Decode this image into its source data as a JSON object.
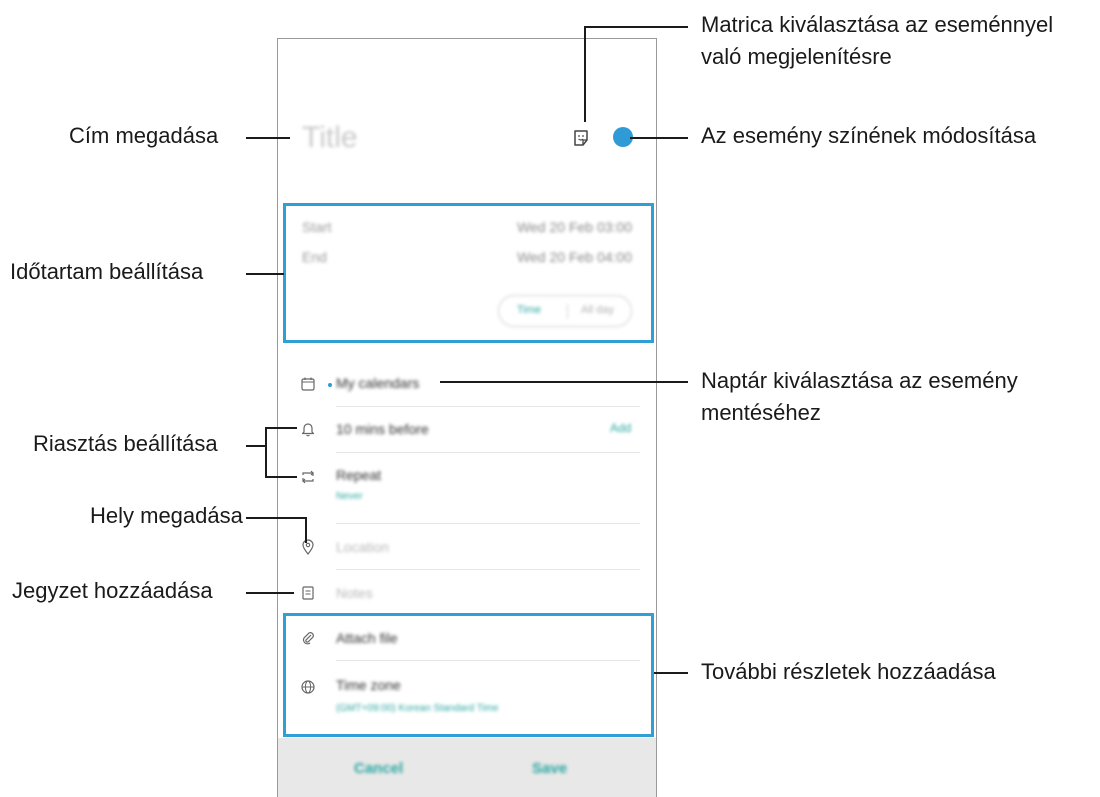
{
  "screen": {
    "title_placeholder": "Title",
    "start_label": "Start",
    "start_value": "Wed 20 Feb  03:00",
    "end_label": "End",
    "end_value": "Wed 20 Feb  04:00",
    "toggle_time": "Time",
    "toggle_allday": "All day",
    "calendar": "My calendars",
    "alert": "10 mins before",
    "alert_add": "Add",
    "repeat": "Repeat",
    "repeat_value": "Never",
    "location": "Location",
    "notes": "Notes",
    "attach": "Attach file",
    "timezone": "Time zone",
    "timezone_value": "(GMT+09:00) Korean Standard Time",
    "cancel": "Cancel",
    "save": "Save",
    "event_color": "#2e9bd6",
    "accent": "#2aa7a0"
  },
  "callouts": {
    "sticker": [
      "Matrica kiválasztása az eseménnyel",
      "való megjelenítésre"
    ],
    "title": "Cím megadása",
    "color": "Az esemény színének módosítása",
    "duration": "Időtartam beállítása",
    "calendar": [
      "Naptár kiválasztása az esemény",
      "mentéséhez"
    ],
    "alarm": "Riasztás beállítása",
    "location": "Hely megadása",
    "note": "Jegyzet hozzáadása",
    "details": "További részletek hozzáadása"
  },
  "colors": {
    "highlight_box": "#2f9fd6",
    "line": "#1b1b1b"
  }
}
